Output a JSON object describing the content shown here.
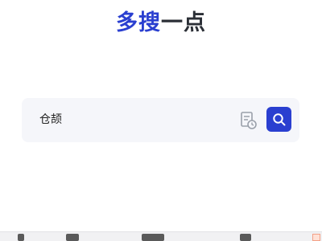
{
  "theme": {
    "accent": "#2a3fd0"
  },
  "logo": {
    "part1": "多搜",
    "part2": "一点"
  },
  "search": {
    "value": "仓颉",
    "history_icon": "history-doc-icon",
    "submit_icon": "search-icon"
  }
}
